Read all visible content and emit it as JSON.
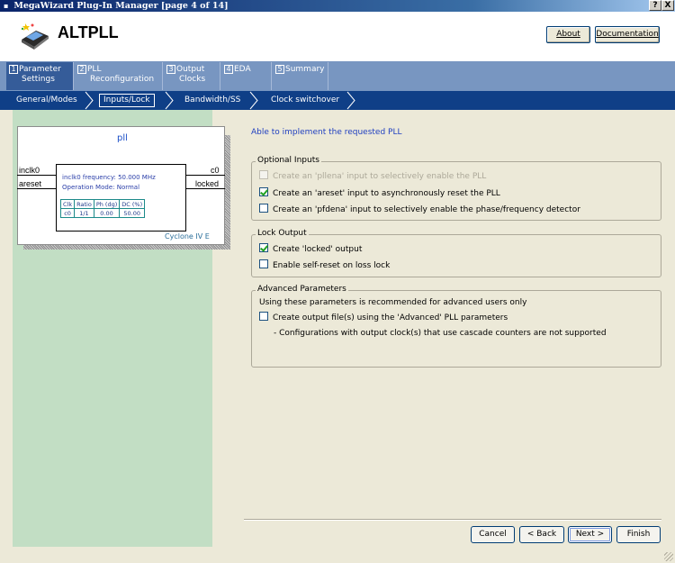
{
  "window": {
    "title": "MegaWizard Plug-In Manager [page 4 of 14]",
    "help_label": "?",
    "close_label": "X"
  },
  "header": {
    "app_title": "ALTPLL",
    "about_label": "About",
    "documentation_label": "Documentation"
  },
  "tabs": [
    {
      "num": "1",
      "line1": "Parameter",
      "line2": "Settings"
    },
    {
      "num": "2",
      "line1": "PLL",
      "line2": "Reconfiguration"
    },
    {
      "num": "3",
      "line1": "Output",
      "line2": "Clocks"
    },
    {
      "num": "4",
      "line1": "EDA",
      "line2": ""
    },
    {
      "num": "5",
      "line1": "Summary",
      "line2": ""
    }
  ],
  "subtabs": [
    "General/Modes",
    "Inputs/Lock",
    "Bandwidth/SS",
    "Clock switchover"
  ],
  "diagram": {
    "title": "pll",
    "inputs": [
      "inclk0",
      "areset"
    ],
    "outputs": [
      "c0",
      "locked"
    ],
    "freq_text": "inclk0 frequency: 50.000 MHz",
    "mode_text": "Operation Mode: Normal",
    "table_headers": [
      "Clk",
      "Ratio",
      "Ph (dg)",
      "DC (%)"
    ],
    "table_rows": [
      [
        "c0",
        "1/1",
        "0.00",
        "50.00"
      ]
    ],
    "family": "Cyclone IV E"
  },
  "status_message": "Able to implement the requested PLL",
  "optional_inputs": {
    "title": "Optional Inputs",
    "options": [
      {
        "label": "Create an 'pllena' input to selectively enable the PLL",
        "checked": false,
        "disabled": true
      },
      {
        "label": "Create an 'areset' input to asynchronously reset the PLL",
        "checked": true,
        "disabled": false
      },
      {
        "label": "Create an 'pfdena' input to selectively enable the phase/frequency detector",
        "checked": false,
        "disabled": false
      }
    ]
  },
  "lock_output": {
    "title": "Lock Output",
    "options": [
      {
        "label": "Create 'locked' output",
        "checked": true,
        "disabled": false
      },
      {
        "label": "Enable self-reset on loss lock",
        "checked": false,
        "disabled": false
      }
    ]
  },
  "advanced": {
    "title": "Advanced Parameters",
    "description": "Using these parameters is recommended for advanced users only",
    "option": {
      "label": "Create output file(s) using the 'Advanced' PLL parameters",
      "checked": false
    },
    "note": "- Configurations with output clock(s) that use cascade counters are not supported"
  },
  "buttons": {
    "cancel": "Cancel",
    "back": "< Back",
    "next": "Next >",
    "finish": "Finish"
  },
  "colors": {
    "title_bar": "#0a246a",
    "tab_strip": "#7896c1",
    "active_tab": "#355c99",
    "subtab_bar": "#0f3f87",
    "left_pane": "#c2dec4",
    "status_text": "#1f3fc0"
  }
}
